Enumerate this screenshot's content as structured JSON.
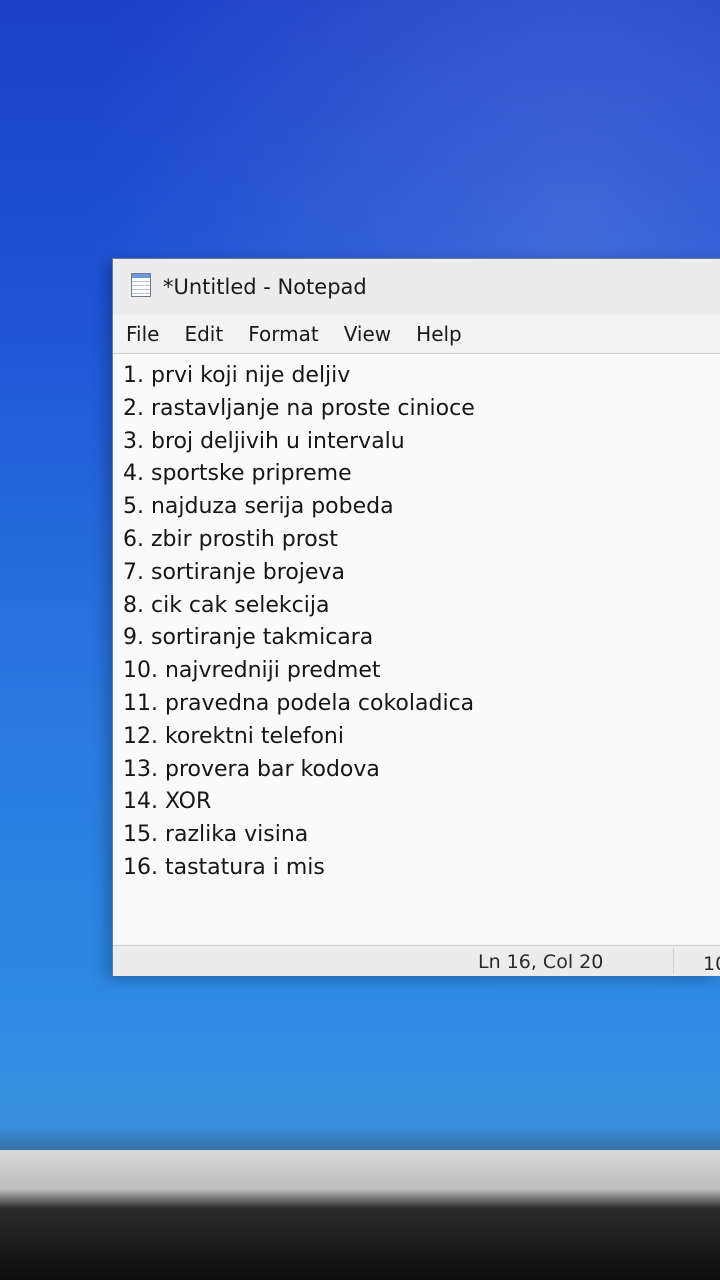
{
  "window": {
    "title": "*Untitled - Notepad",
    "icon": "notepad-icon"
  },
  "menu": {
    "items": [
      "File",
      "Edit",
      "Format",
      "View",
      "Help"
    ]
  },
  "editor": {
    "lines": [
      "1. prvi koji nije deljiv",
      "2. rastavljanje na proste cinioce",
      "3. broj deljivih u intervalu",
      "4. sportske pripreme",
      "5. najduza serija pobeda",
      "6. zbir prostih prost",
      "7. sortiranje brojeva",
      "8. cik cak selekcija",
      "9. sortiranje takmicara",
      "10. najvredniji predmet",
      "11. pravedna podela cokoladica",
      "12. korektni telefoni",
      "13. provera bar kodova",
      "14. XOR",
      "15. razlika visina",
      "16. tastatura i mis"
    ]
  },
  "status": {
    "position": "Ln 16, Col 20",
    "zoom_partial": "10"
  }
}
